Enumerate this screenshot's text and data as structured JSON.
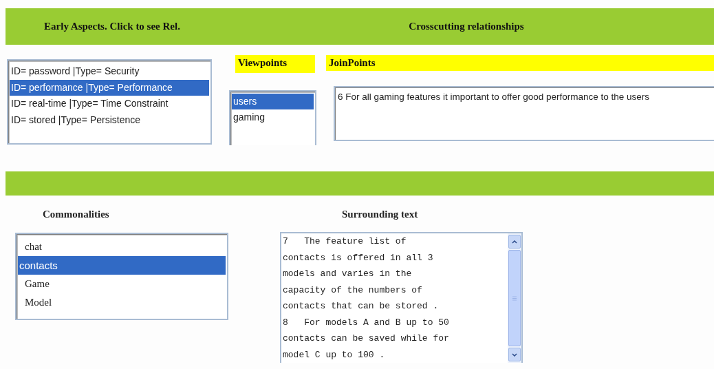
{
  "top_bar": {
    "left_title": "Early Aspects. Click to see Rel.",
    "right_title": "Crosscutting relationships"
  },
  "aspects": [
    {
      "label": "ID= password |Type= Security",
      "selected": false
    },
    {
      "label": "ID= performance |Type= Performance",
      "selected": true
    },
    {
      "label": "ID= real-time |Type= Time Constraint",
      "selected": false
    },
    {
      "label": "ID= stored |Type= Persistence",
      "selected": false
    }
  ],
  "viewpoints": {
    "title": "Viewpoints",
    "items": [
      {
        "label": "users",
        "selected": true
      },
      {
        "label": "gaming",
        "selected": false
      }
    ]
  },
  "joinpoints": {
    "title": "JoinPoints",
    "text": "6 For all gaming features it important to offer good performance to the users"
  },
  "commonalities": {
    "title": "Commonalities",
    "items": [
      {
        "label": "chat",
        "selected": false
      },
      {
        "label": "contacts",
        "selected": true
      },
      {
        "label": "Game",
        "selected": false
      },
      {
        "label": "Model",
        "selected": false
      }
    ]
  },
  "surrounding": {
    "title": "Surrounding text",
    "lines": [
      "7   The feature list of",
      "contacts is offered in all 3",
      "models and varies in the",
      "capacity of the numbers of",
      "contacts that can be stored .",
      "8   For models A and B up to 50",
      "contacts can be saved while for",
      "model C up to 100 ."
    ]
  }
}
